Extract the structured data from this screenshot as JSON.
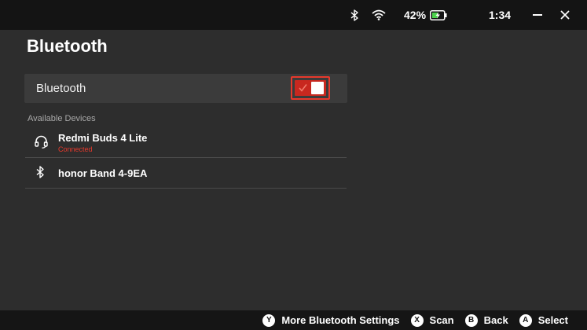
{
  "status_bar": {
    "battery_percent": "42%",
    "time": "1:34",
    "bluetooth_icon": "bluetooth-icon",
    "wifi_icon": "wifi-icon",
    "battery_icon": "battery-charging-icon",
    "minimize_icon": "minimize-icon",
    "close_icon": "close-icon"
  },
  "page": {
    "title": "Bluetooth"
  },
  "bluetooth_toggle": {
    "label": "Bluetooth",
    "enabled": true
  },
  "devices": {
    "section_title": "Available Devices",
    "items": [
      {
        "name": "Redmi Buds 4 Lite",
        "status": "Connected",
        "icon": "headset-icon"
      },
      {
        "name": "honor Band 4-9EA",
        "icon": "bluetooth-icon"
      }
    ]
  },
  "footer": {
    "hints": [
      {
        "button": "Y",
        "label": "More Bluetooth Settings"
      },
      {
        "button": "X",
        "label": "Scan"
      },
      {
        "button": "B",
        "label": "Back"
      },
      {
        "button": "A",
        "label": "Select"
      }
    ]
  },
  "colors": {
    "accent": "#e8392c",
    "toggle_fill": "#c8281f",
    "background": "#2d2d2d",
    "topbar": "#141414"
  }
}
